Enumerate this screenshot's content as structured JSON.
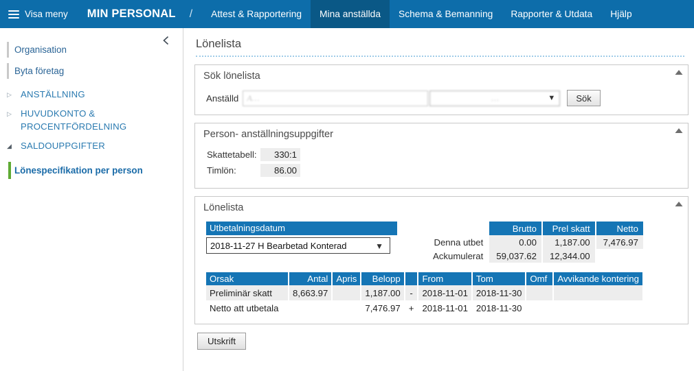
{
  "topnav": {
    "menu_toggle_label": "Visa meny",
    "brand": "MIN PERSONAL",
    "separator": "/",
    "items": [
      {
        "label": "Attest & Rapportering",
        "active": false
      },
      {
        "label": "Mina anställda",
        "active": true
      },
      {
        "label": "Schema & Bemanning",
        "active": false
      },
      {
        "label": "Rapporter & Utdata",
        "active": false
      },
      {
        "label": "Hjälp",
        "active": false
      }
    ]
  },
  "sidebar": {
    "links": [
      {
        "label": "Organisation"
      },
      {
        "label": "Byta företag"
      }
    ],
    "groups": [
      {
        "label": "ANSTÄLLNING",
        "expanded": false,
        "marker": "▷"
      },
      {
        "label": "HUVUDKONTO & PROCENTFÖRDELNING",
        "expanded": false,
        "marker": "▷"
      },
      {
        "label": "SALDOUPPGIFTER",
        "expanded": true,
        "marker": "◢"
      }
    ],
    "active_item": "Lönespecifikation per person"
  },
  "page": {
    "title": "Lönelista"
  },
  "search_panel": {
    "title": "Sök lönelista",
    "employee_label": "Anställd",
    "employee_value": "A…",
    "period_value": "…",
    "search_button": "Sök"
  },
  "person_panel": {
    "title": "Person- anställningsuppgifter",
    "rows": [
      {
        "label": "Skattetabell:",
        "value": "330:1"
      },
      {
        "label": "Timlön:",
        "value": "86.00"
      }
    ]
  },
  "lonelista_panel": {
    "title": "Lönelista",
    "date_header": "Utbetalningsdatum",
    "date_selected": "2018-11-27 H Bearbetad Konterad",
    "summary": {
      "columns": [
        "Brutto",
        "Prel skatt",
        "Netto"
      ],
      "rows": [
        {
          "label": "Denna utbet",
          "values": [
            "0.00",
            "1,187.00",
            "7,476.97"
          ]
        },
        {
          "label": "Ackumulerat",
          "values": [
            "59,037.62",
            "12,344.00",
            ""
          ]
        }
      ]
    },
    "detail": {
      "columns": [
        "Orsak",
        "Antal",
        "Apris",
        "Belopp",
        "",
        "From",
        "Tom",
        "Omf",
        "Avvikande kontering"
      ],
      "rows": [
        {
          "orsak": "Preliminär skatt",
          "antal": "8,663.97",
          "apris": "",
          "belopp": "1,187.00",
          "sign": "-",
          "from": "2018-11-01",
          "tom": "2018-11-30",
          "omf": "",
          "kontering": ""
        },
        {
          "orsak": "Netto att utbetala",
          "antal": "",
          "apris": "",
          "belopp": "7,476.97",
          "sign": "+",
          "from": "2018-11-01",
          "tom": "2018-11-30",
          "omf": "",
          "kontering": ""
        }
      ]
    },
    "print_button": "Utskrift"
  },
  "colors": {
    "nav_blue": "#0d6daa",
    "nav_active_blue": "#0a5886",
    "table_header_blue": "#1575b5",
    "accent_green": "#5faa34",
    "link_blue": "#2a7ab0"
  }
}
